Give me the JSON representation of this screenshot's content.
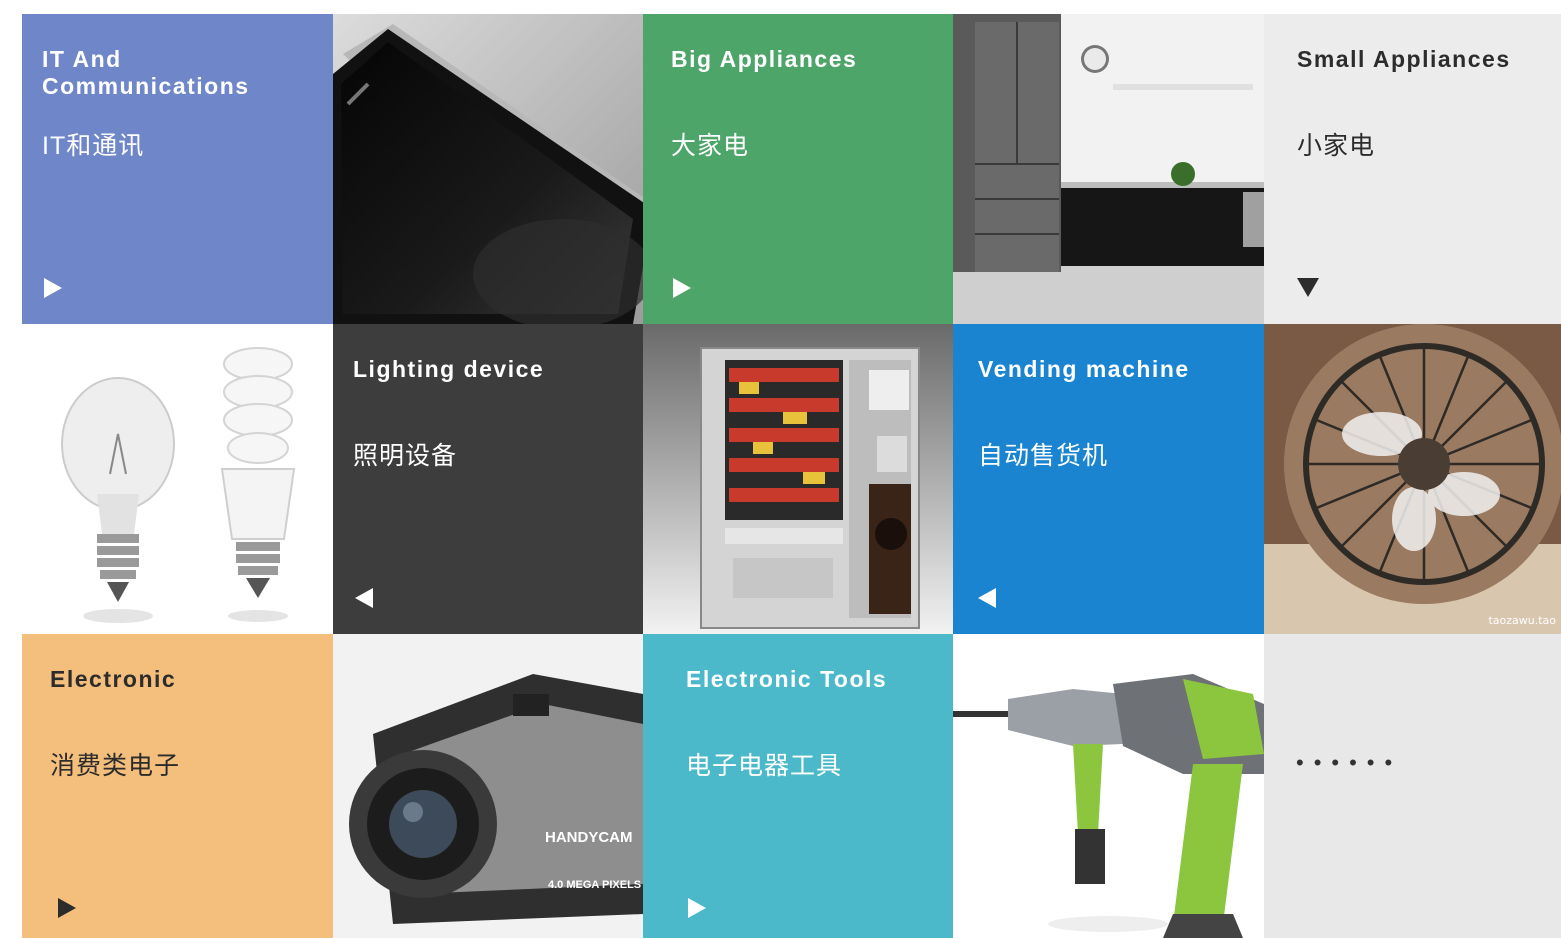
{
  "colors": {
    "it": "#6f87c9",
    "big": "#4ea56a",
    "small": "#ececec",
    "lighting": "#3d3d3d",
    "vending": "#1a84d0",
    "electronic": "#f4be7c",
    "tools": "#4cb9cb",
    "more": "#e8e8e8"
  },
  "tiles": {
    "it": {
      "title": "IT And\nCommunications",
      "subtitle": "IT和通讯",
      "arrow": "right"
    },
    "big": {
      "title": "Big Appliances",
      "subtitle": "大家电",
      "arrow": "right"
    },
    "small": {
      "title": "Small Appliances",
      "subtitle": "小家电",
      "arrow": "down"
    },
    "lighting": {
      "title": "Lighting device",
      "subtitle": "照明设备",
      "arrow": "left"
    },
    "vending": {
      "title": "Vending machine",
      "subtitle": "自动售货机",
      "arrow": "left"
    },
    "electronic": {
      "title": "Electronic",
      "subtitle": "消费类电子",
      "arrow": "right"
    },
    "tools": {
      "title": "Electronic Tools",
      "subtitle": "电子电器工具",
      "arrow": "right"
    },
    "more": {
      "dots": "••••••"
    }
  },
  "images": {
    "smartphone": "smartphone-photo",
    "kitchen": "kitchen-photo",
    "bulbs": "light-bulbs-photo",
    "vending": "vending-machine-photo",
    "fan": "desk-fan-photo",
    "camcorder": "camcorder-photo",
    "drill": "power-drill-photo"
  },
  "watermark": "taozawu.tao",
  "camcorder_brand": "HANDYCAM",
  "camcorder_spec": "4.0 MEGA PIXELS"
}
